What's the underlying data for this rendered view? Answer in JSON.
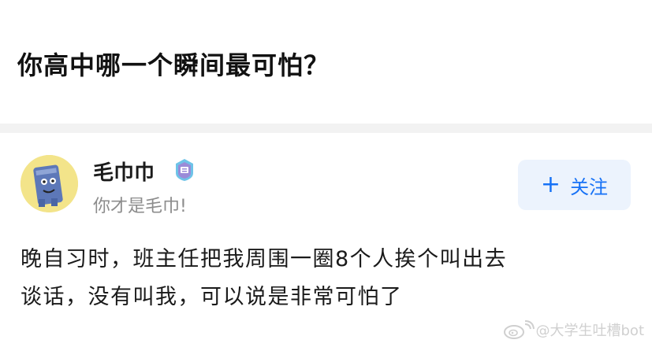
{
  "question": {
    "title": "你高中哪一个瞬间最可怕？"
  },
  "author": {
    "name": "毛巾巾",
    "bio": "你才是毛巾!",
    "badge_icon": "verified-badge-icon",
    "avatar_icon": "towel-avatar-icon"
  },
  "follow_button": {
    "label": "关注",
    "icon": "plus-icon"
  },
  "answer": {
    "lines": [
      "晚自习时，班主任把我周围一圈8个人挨个叫出去",
      "谈话，没有叫我，可以说是非常可怕了"
    ]
  },
  "watermark": {
    "text": "@大学生吐槽bot",
    "icon": "weibo-icon"
  },
  "colors": {
    "accent": "#1772f6",
    "follow_bg": "#ecf3fd",
    "muted_text": "#8c8c8c",
    "divider": "#f2f2f2"
  }
}
